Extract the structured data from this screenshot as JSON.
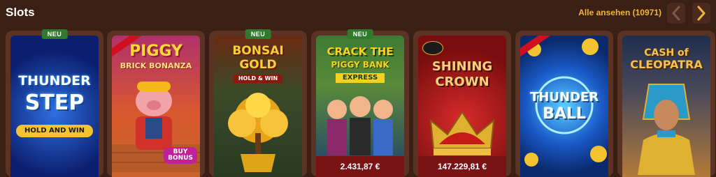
{
  "header": {
    "title": "Slots",
    "see_all": "Alle ansehen (10971)"
  },
  "games": [
    {
      "badge": "NEU",
      "lines": [
        "THUNDER",
        "STEP"
      ],
      "subtitle": "HOLD AND WIN",
      "jackpot": null,
      "colors": {
        "bg1": "#0b1f6e",
        "bg2": "#1d4ec2",
        "title": "#ffffff",
        "accent": "#f4c430"
      }
    },
    {
      "badge": null,
      "lines": [
        "PIGGY",
        "BRICK BONANZA"
      ],
      "subtitle": "BUY BONUS",
      "jackpot": null,
      "colors": {
        "bg1": "#b0316a",
        "bg2": "#e76f2c",
        "title": "#ffd83a",
        "accent": "#c73a1f"
      }
    },
    {
      "badge": "NEU",
      "lines": [
        "BONSAI",
        "GOLD"
      ],
      "subtitle": "HOLD & WIN",
      "jackpot": null,
      "colors": {
        "bg1": "#2a4a28",
        "bg2": "#6a5a20",
        "title": "#f6cf3c",
        "accent": "#c62a1f"
      }
    },
    {
      "badge": "NEU",
      "lines": [
        "CRACK THE",
        "PIGGY BANK"
      ],
      "subtitle": "EXPRESS",
      "jackpot": "2.431,87 €",
      "colors": {
        "bg1": "#3d7a34",
        "bg2": "#1f3e6e",
        "title": "#f4d21f",
        "accent": "#2d8a3c"
      }
    },
    {
      "badge": null,
      "lines": [
        "SHINING",
        "CROWN"
      ],
      "subtitle": null,
      "jackpot": "147.229,81 €",
      "colors": {
        "bg1": "#7a0e0e",
        "bg2": "#c42222",
        "title": "#f6d27a",
        "accent": "#e0b030"
      }
    },
    {
      "badge": null,
      "lines": [
        "THUNDER",
        "BALL"
      ],
      "subtitle": null,
      "jackpot": null,
      "colors": {
        "bg1": "#0b2a6e",
        "bg2": "#2f8ee0",
        "title": "#ffffff",
        "accent": "#f4c430"
      }
    },
    {
      "badge": null,
      "lines": [
        "CASH of",
        "CLEOPATRA"
      ],
      "subtitle": null,
      "jackpot": null,
      "colors": {
        "bg1": "#1f2f4e",
        "bg2": "#b27a3a",
        "title": "#f6c24a",
        "accent": "#2a9ac8"
      }
    }
  ]
}
